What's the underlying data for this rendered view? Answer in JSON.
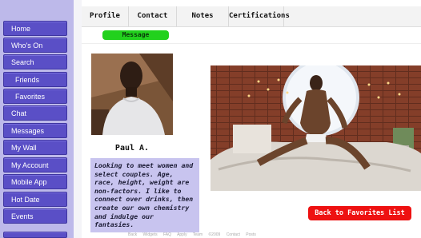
{
  "sidebar": {
    "items": [
      {
        "label": "Home"
      },
      {
        "label": "Who's On"
      },
      {
        "label": "Search"
      },
      {
        "label": "Friends"
      },
      {
        "label": "Favorites"
      },
      {
        "label": "Chat"
      },
      {
        "label": "Messages"
      },
      {
        "label": "My Wall"
      },
      {
        "label": "My Account"
      },
      {
        "label": "Mobile App"
      },
      {
        "label": "Hot Date"
      },
      {
        "label": "Events"
      }
    ]
  },
  "tabs": [
    {
      "label": "Profile"
    },
    {
      "label": "Contact"
    },
    {
      "label": "Notes"
    },
    {
      "label": "Certifications"
    }
  ],
  "profile": {
    "message_label": "Message",
    "name": "Paul A.",
    "bio": "Looking to meet women and select couples. Age, race, height, weight are non-factors. I like to connect over drinks, then create our own chemistry and indulge our fantasies.",
    "back_label": "Back to Favorites List"
  },
  "footer": {
    "text": "Back Widgets FAQ Apply Team ©2009 Contact Posts"
  },
  "colors": {
    "sidebar_button": "#5a4fc6",
    "sidebar_bg": "#bdb9ea",
    "message_button": "#22d11d",
    "back_button": "#ee1111",
    "bio_bg": "#c8c4ef"
  }
}
